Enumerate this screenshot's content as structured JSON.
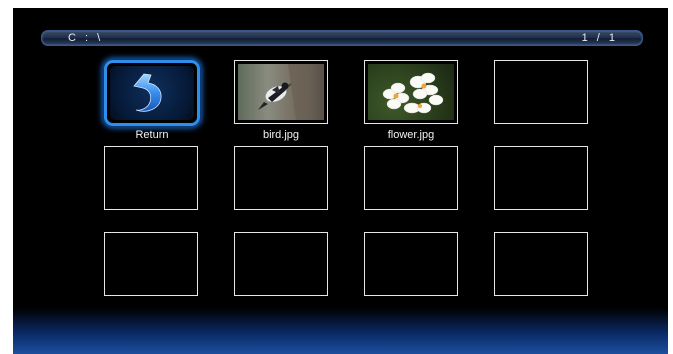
{
  "path_bar": {
    "path": "C : \\",
    "page": "1 / 1"
  },
  "items": [
    {
      "name": "Return",
      "type": "return",
      "icon": "return-arrow-icon"
    },
    {
      "name": "bird.jpg",
      "type": "image"
    },
    {
      "name": "flower.jpg",
      "type": "image"
    }
  ],
  "empty_slots": 9,
  "colors": {
    "accent": "#2f8fe8",
    "background": "#000000",
    "frame": "#e6e6e6"
  }
}
